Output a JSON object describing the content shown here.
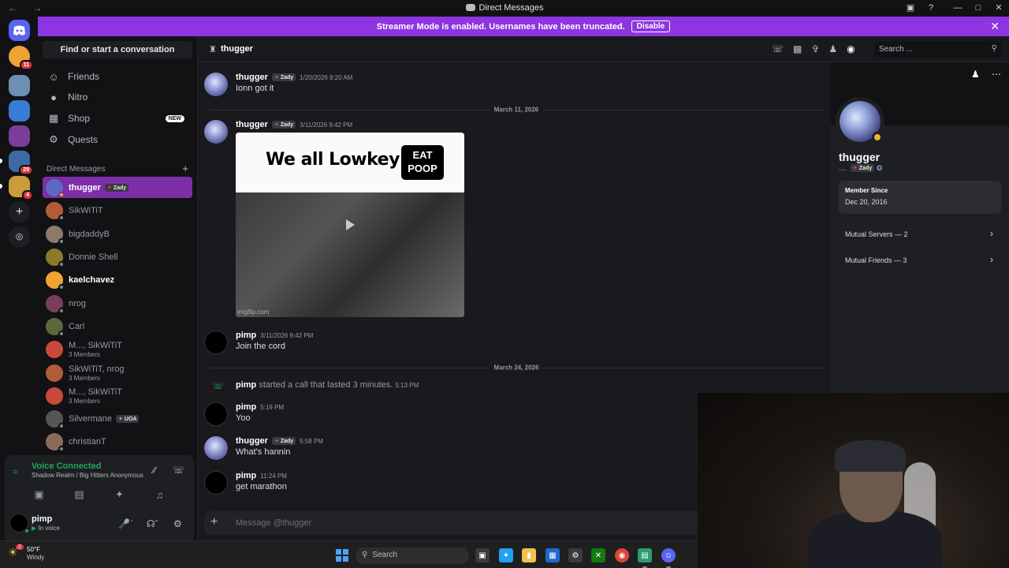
{
  "window": {
    "title": "Direct Messages"
  },
  "banner": {
    "text": "Streamer Mode is enabled. Usernames have been truncated.",
    "button": "Disable"
  },
  "guilds": [
    {
      "name": "discord-home",
      "color": "#5865f2",
      "badge": ""
    },
    {
      "name": "dm-notif",
      "color": "#f0a232",
      "badge": "11"
    },
    {
      "name": "server-1",
      "color": "#6c8fb3",
      "badge": ""
    },
    {
      "name": "server-2",
      "color": "#3a7bd5",
      "badge": ""
    },
    {
      "name": "server-3",
      "color": "#7a3d9a",
      "badge": ""
    },
    {
      "name": "server-4",
      "color": "#3d6aa5",
      "badge": "29"
    },
    {
      "name": "server-5",
      "color": "#c99c3c",
      "badge": "4"
    }
  ],
  "sidebar": {
    "find_placeholder": "Find or start a conversation",
    "nav": [
      {
        "label": "Friends",
        "icon": "friends-icon",
        "badge": ""
      },
      {
        "label": "Nitro",
        "icon": "nitro-icon",
        "badge": ""
      },
      {
        "label": "Shop",
        "icon": "shop-icon",
        "badge": "NEW"
      },
      {
        "label": "Quests",
        "icon": "quests-icon",
        "badge": ""
      }
    ],
    "dm_header": "Direct Messages",
    "dms": [
      {
        "name": "thugger",
        "tag": "Zady",
        "sub": "",
        "color": "#5c6bc0",
        "active": true
      },
      {
        "name": "SikWiTiT",
        "tag": "",
        "sub": "",
        "color": "#b35a3a"
      },
      {
        "name": "bigdaddyB",
        "tag": "",
        "sub": "",
        "color": "#8c7a6b"
      },
      {
        "name": "Donnie Shell",
        "tag": "",
        "sub": "",
        "color": "#8a7a2a"
      },
      {
        "name": "kaelchavez",
        "tag": "",
        "sub": "",
        "color": "#f0a232",
        "bold": true
      },
      {
        "name": "nrog",
        "tag": "",
        "sub": "",
        "color": "#7a3d5a"
      },
      {
        "name": "Carl",
        "tag": "",
        "sub": "",
        "color": "#5b6a3a"
      },
      {
        "name": "M..., SikWiTiT",
        "tag": "",
        "sub": "3 Members",
        "color": "#c84a3a"
      },
      {
        "name": "SikWiTiT, nrog",
        "tag": "",
        "sub": "3 Members",
        "color": "#b35a3a"
      },
      {
        "name": "M..., SikWiTiT",
        "tag": "",
        "sub": "3 Members",
        "color": "#c84a3a"
      },
      {
        "name": "Silvermane",
        "tag": "UOA",
        "sub": "",
        "color": "#555555"
      },
      {
        "name": "christianT",
        "tag": "",
        "sub": "",
        "color": "#8c6a5a"
      }
    ]
  },
  "voice": {
    "title": "Voice Connected",
    "channel": "Shadow Realm / Big Hitters Anonymous"
  },
  "user": {
    "name": "pimp",
    "status": "In voice"
  },
  "chat": {
    "recipient": "thugger",
    "search_placeholder": "Search ...",
    "composer_placeholder": "Message @thugger",
    "messages": [
      {
        "author": "thugger",
        "tag": "Zady",
        "time": "1/20/2026 9:20 AM",
        "text": "Ionn got it"
      },
      {
        "divider": "March 11, 2026"
      },
      {
        "author": "thugger",
        "tag": "Zady",
        "time": "3/11/2026 9:42 PM",
        "text": ""
      },
      {
        "author": "pimp",
        "tag": "",
        "time": "3/11/2026 9:42 PM",
        "text": "Join the cord"
      },
      {
        "divider": "March 24, 2026"
      },
      {
        "call": true,
        "author": "pimp",
        "text": "started a call that lasted 3 minutes.",
        "time": "5:13 PM"
      },
      {
        "author": "pimp",
        "tag": "",
        "time": "5:19 PM",
        "text": "Yoo"
      },
      {
        "author": "thugger",
        "tag": "Zady",
        "time": "5:58 PM",
        "text": "What's hannin"
      },
      {
        "author": "pimp",
        "tag": "",
        "time": "11:24 PM",
        "text": "get marathon"
      }
    ],
    "gif": {
      "caption": "We all Lowkey",
      "box_line1": "EAT",
      "box_line2": "POOP",
      "watermark": "imgflip.com"
    }
  },
  "profile": {
    "name": "thugger",
    "handle": "....",
    "tag": "Zady",
    "member_since_label": "Member Since",
    "member_since": "Dec 20, 2016",
    "mutual_servers": "Mutual Servers — 2",
    "mutual_friends": "Mutual Friends — 3"
  },
  "taskbar": {
    "temp": "50°F",
    "weather": "Windy",
    "weather_badge": "2",
    "search": "Search"
  }
}
